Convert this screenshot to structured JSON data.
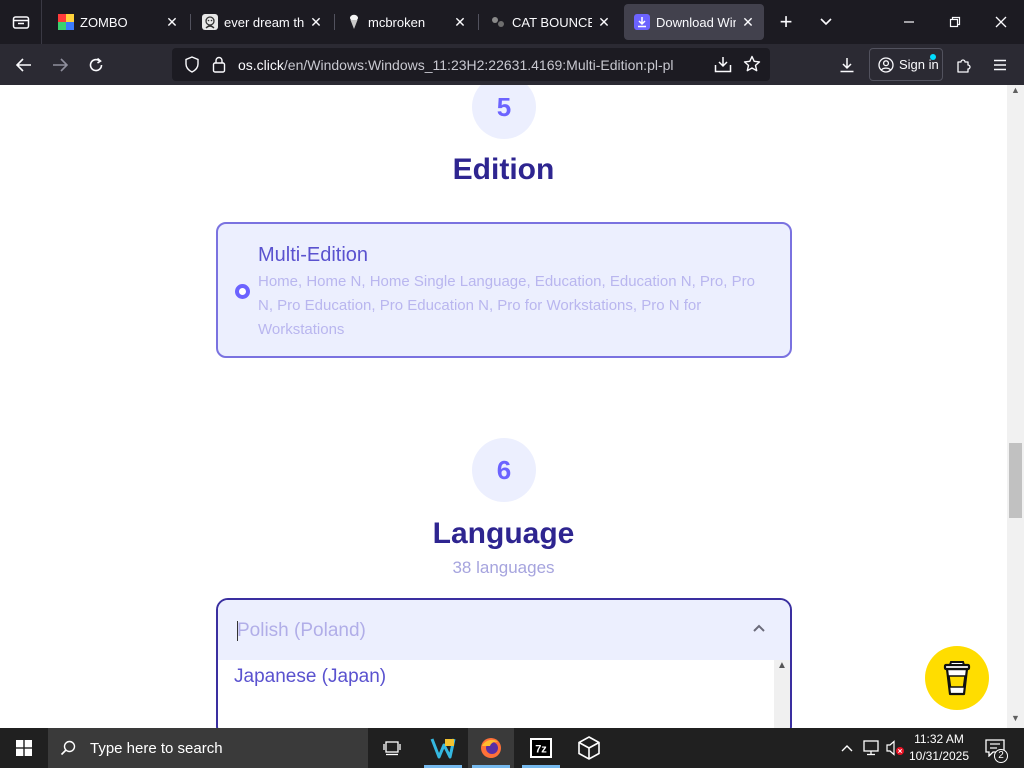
{
  "browser": {
    "tabs": [
      {
        "title": "ZOMBO",
        "active": false
      },
      {
        "title": "ever dream this",
        "active": false
      },
      {
        "title": "mcbroken",
        "active": false
      },
      {
        "title": "CAT BOUNCE!",
        "active": false
      },
      {
        "title": "Download Wind",
        "active": true
      }
    ],
    "url": {
      "host": "os.click",
      "path": "/en/Windows:Windows_11:23H2:22631.4169:Multi-Edition:pl-pl"
    },
    "sign_in_label": "Sign in"
  },
  "page": {
    "edition_section": {
      "step": "5",
      "title": "Edition",
      "selected": {
        "name": "Multi-Edition",
        "description": "Home, Home N, Home Single Language, Education, Education N, Pro, Pro N, Pro Education, Pro Education N, Pro for Workstations, Pro N for Workstations"
      }
    },
    "language_section": {
      "step": "6",
      "title": "Language",
      "count_label": "38 languages",
      "selected_value": "Polish (Poland)",
      "visible_options": [
        "Japanese (Japan)"
      ]
    }
  },
  "taskbar": {
    "search_placeholder": "Type here to search",
    "time": "11:32 AM",
    "date": "10/31/2025",
    "notification_count": "2",
    "apps": [
      "task-view",
      "visual-studio-code",
      "firefox",
      "7-zip",
      "unity"
    ]
  },
  "colors": {
    "accent": "#6c63ff",
    "title": "#2e2590",
    "card_bg": "#eceffe",
    "coffee_button": "#ffdd00"
  }
}
